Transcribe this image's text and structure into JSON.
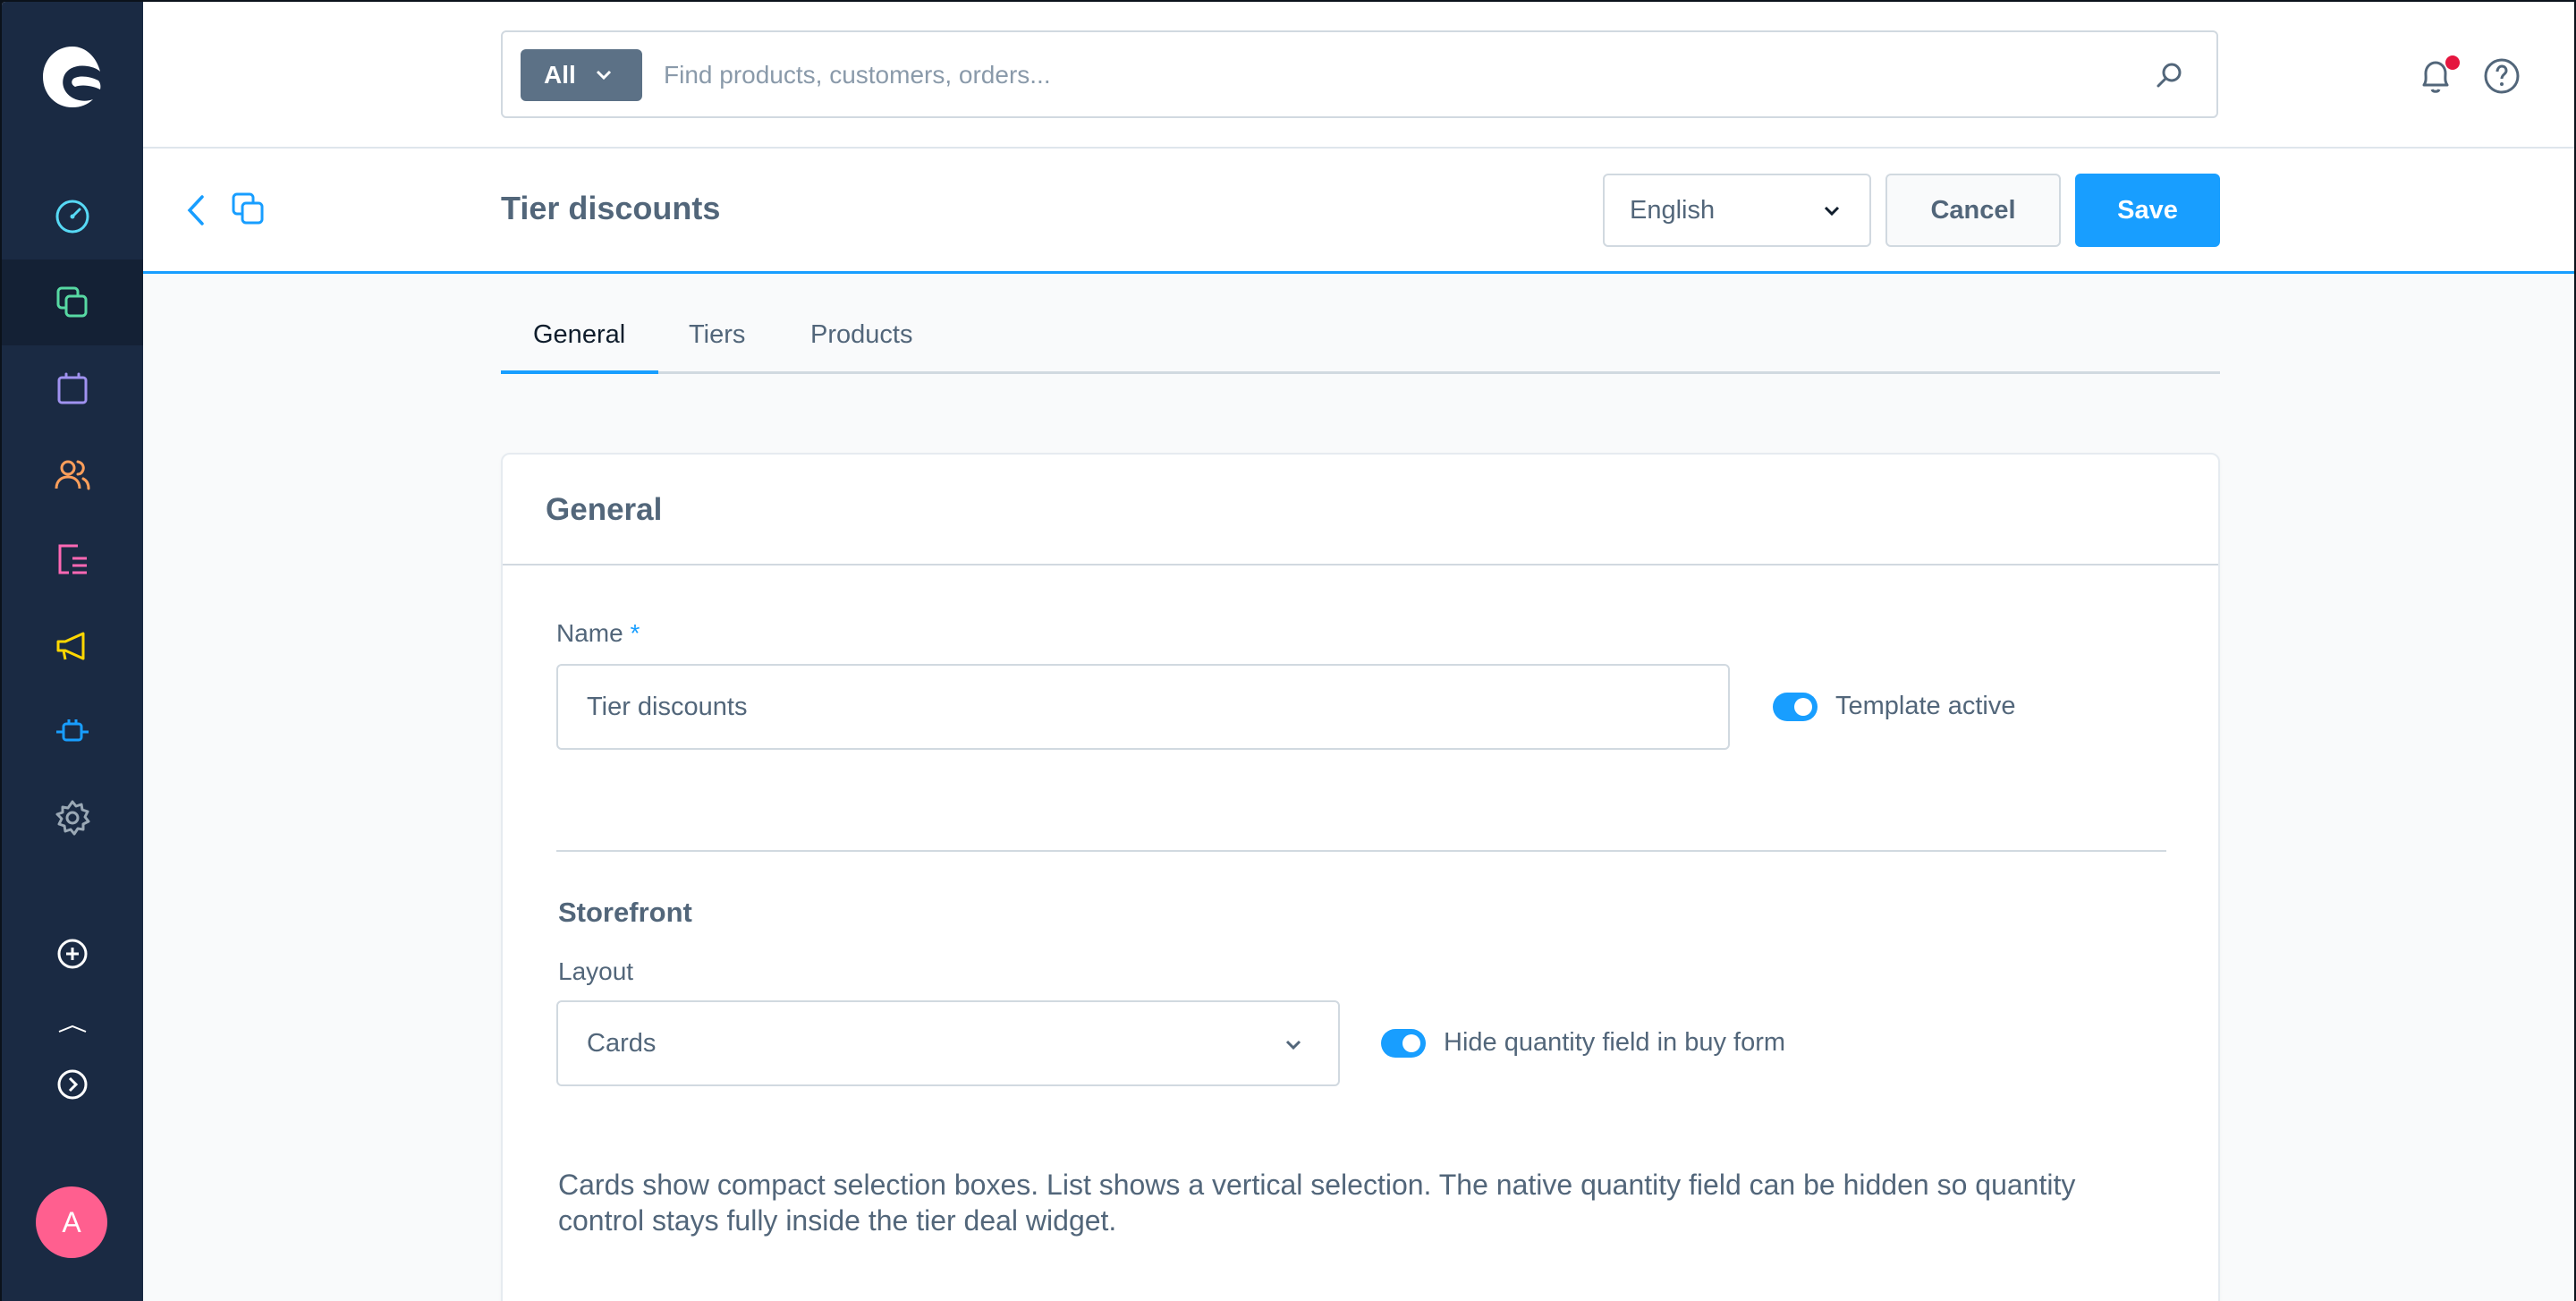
{
  "sidebar": {
    "items": [
      {
        "name": "dashboard",
        "color": "#57d9f5"
      },
      {
        "name": "catalogues",
        "color": "#57d9a3"
      },
      {
        "name": "orders",
        "color": "#a092f0"
      },
      {
        "name": "customers",
        "color": "#ff9f5b"
      },
      {
        "name": "content",
        "color": "#ff68b4"
      },
      {
        "name": "marketing",
        "color": "#ffd700"
      },
      {
        "name": "extensions",
        "color": "#189eff"
      },
      {
        "name": "settings",
        "color": "#9aa8b5"
      }
    ],
    "avatar_initial": "A",
    "avatar_color": "#ff5f8f"
  },
  "search": {
    "type_label": "All",
    "placeholder": "Find products, customers, orders..."
  },
  "smartbar": {
    "title": "Tier discounts",
    "language": "English",
    "cancel_label": "Cancel",
    "save_label": "Save"
  },
  "tabs": [
    {
      "label": "General",
      "active": true
    },
    {
      "label": "Tiers",
      "active": false
    },
    {
      "label": "Products",
      "active": false
    }
  ],
  "card": {
    "title": "General",
    "name_label": "Name",
    "name_required": "*",
    "name_value": "Tier discounts",
    "template_active_label": "Template active",
    "template_active": true,
    "storefront_title": "Storefront",
    "layout_label": "Layout",
    "layout_value": "Cards",
    "hide_qty_label": "Hide quantity field in buy form",
    "hide_qty": true,
    "help_text": "Cards show compact selection boxes. List shows a vertical selection. The native quantity field can be hidden so quantity control stays fully inside the tier deal widget."
  },
  "colors": {
    "accent": "#189eff",
    "sidebar_bg": "#1a2a43",
    "notification_dot": "#e5163f"
  }
}
